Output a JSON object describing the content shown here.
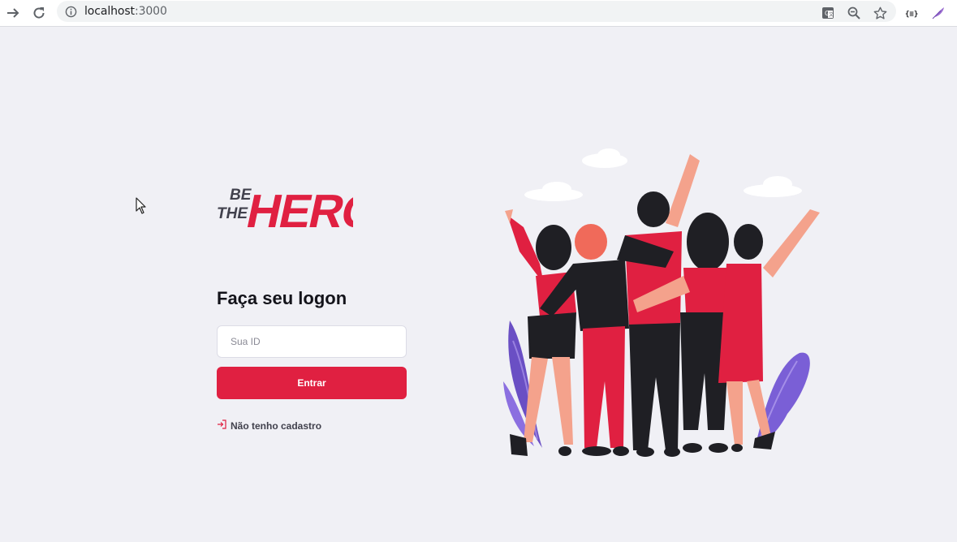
{
  "browser": {
    "url_host": "localhost",
    "url_port": ":3000",
    "icons": [
      "back-arrow-icon",
      "reload-icon",
      "info-icon",
      "translate-icon",
      "zoom-out-icon",
      "bookmark-star-icon",
      "json-extension-icon",
      "feather-extension-icon"
    ]
  },
  "logon": {
    "title": "Faça seu logon",
    "id_placeholder": "Sua ID",
    "submit_label": "Entrar",
    "register_label": "Não tenho cadastro"
  },
  "logo": {
    "line1": "BE",
    "line2": "THE",
    "word": "HERO"
  },
  "colors": {
    "accent": "#e02041",
    "background": "#f0f0f5",
    "text_dark": "#13131a",
    "text_muted": "#41414d"
  }
}
